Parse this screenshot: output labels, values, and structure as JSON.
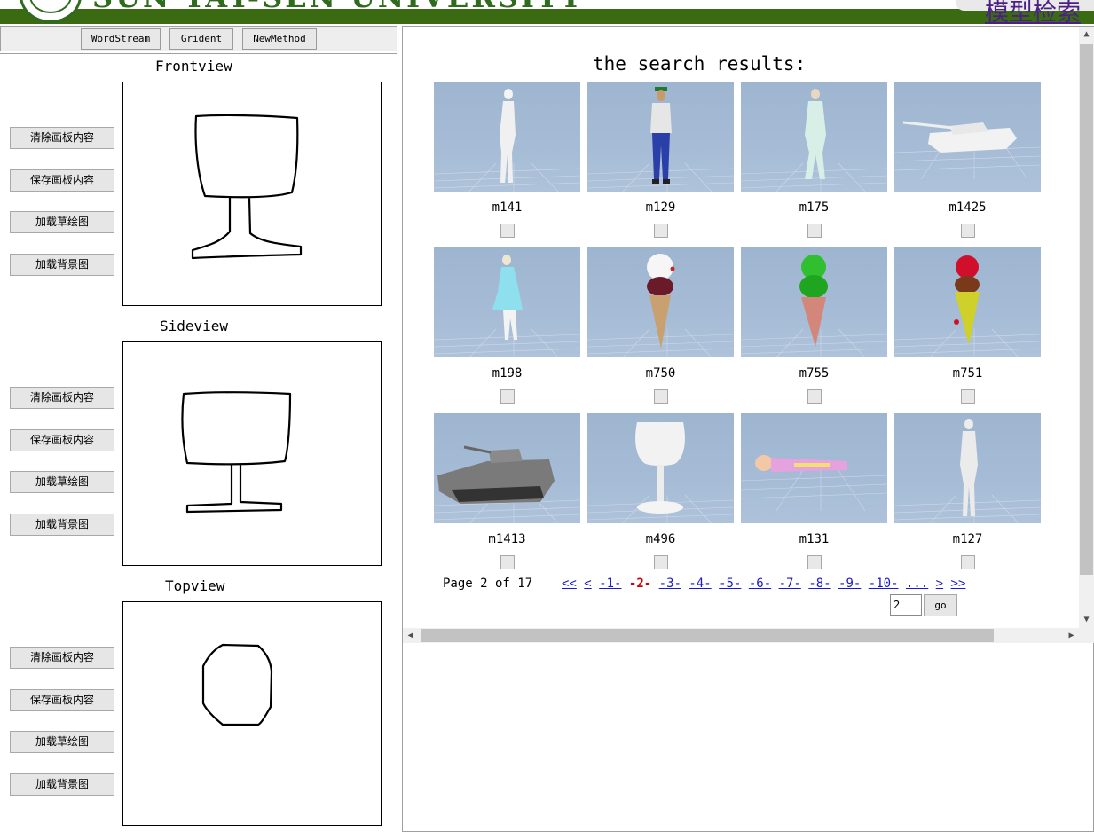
{
  "header": {
    "university_title": "SUN YAT-SEN UNIVERSITY",
    "top_link": "模型检索"
  },
  "methods": {
    "wordstream": "WordStream",
    "grident": "Grident",
    "newmethod": "NewMethod"
  },
  "views": [
    {
      "title": "Frontview",
      "buttons": [
        "清除画板内容",
        "保存画板内容",
        "加载草绘图",
        "加载背景图"
      ]
    },
    {
      "title": "Sideview",
      "buttons": [
        "清除画板内容",
        "保存画板内容",
        "加载草绘图",
        "加载背景图"
      ]
    },
    {
      "title": "Topview",
      "buttons": [
        "清除画板内容",
        "保存画板内容",
        "加载草绘图",
        "加载背景图"
      ]
    }
  ],
  "results": {
    "title": "the search results:",
    "items": [
      {
        "label": "m141",
        "icon": "humanoid-model-icon"
      },
      {
        "label": "m129",
        "icon": "man-with-cap-model-icon"
      },
      {
        "label": "m175",
        "icon": "humanoid-model-icon"
      },
      {
        "label": "m1425",
        "icon": "tank-model-icon"
      },
      {
        "label": "m198",
        "icon": "woman-in-dress-model-icon"
      },
      {
        "label": "m750",
        "icon": "ice-cream-model-icon"
      },
      {
        "label": "m755",
        "icon": "ice-cream-green-model-icon"
      },
      {
        "label": "m751",
        "icon": "ice-cream-red-model-icon"
      },
      {
        "label": "m1413",
        "icon": "armored-vehicle-model-icon"
      },
      {
        "label": "m496",
        "icon": "goblet-model-icon"
      },
      {
        "label": "m131",
        "icon": "lying-figure-model-icon"
      },
      {
        "label": "m127",
        "icon": "humanoid-model-icon"
      }
    ]
  },
  "pager": {
    "info": "Page 2 of 17",
    "first": "<<",
    "prev": "<",
    "pages": [
      "-1-",
      "-2-",
      "-3-",
      "-4-",
      "-5-",
      "-6-",
      "-7-",
      "-8-",
      "-9-",
      "-10-",
      "..."
    ],
    "current": "-2-",
    "next": ">",
    "last": ">>",
    "input_value": "2",
    "go_label": "go"
  },
  "colors": {
    "header_green": "#3a6b12",
    "link_blue": "#1a1acc",
    "current_page_red": "#cc0000",
    "thumb_sky": "#a6bcd6"
  }
}
